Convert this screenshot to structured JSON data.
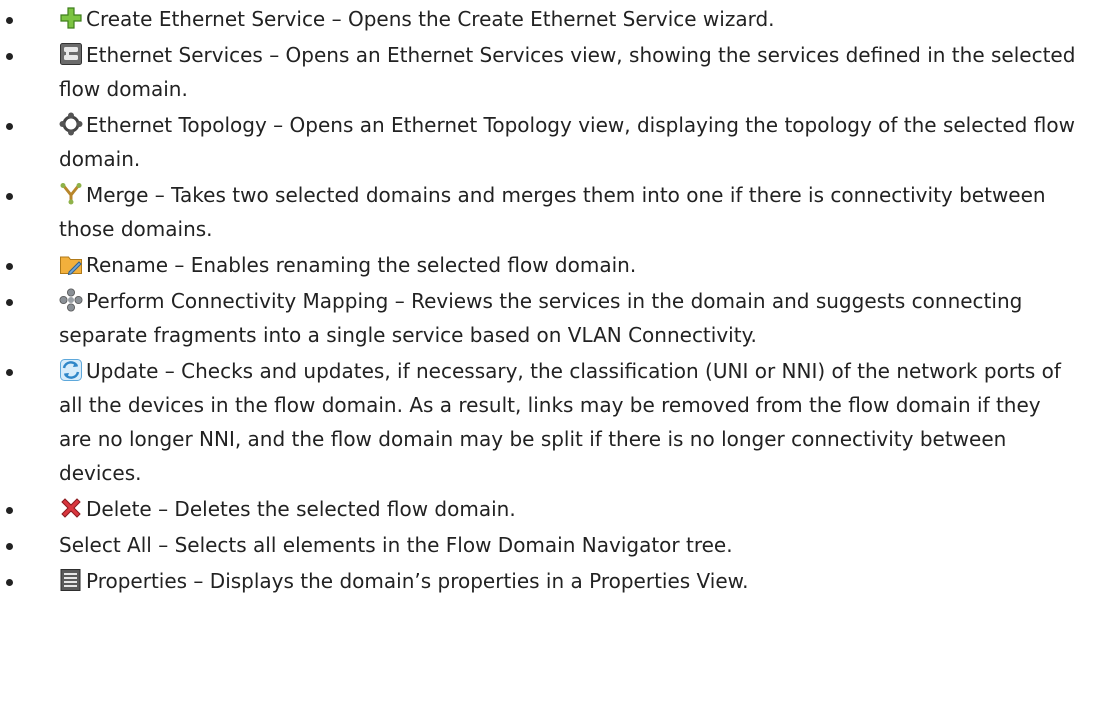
{
  "items": [
    {
      "icon": "create-ethernet-service-icon",
      "text": "Create Ethernet Service – Opens the Create Ethernet Service wizard."
    },
    {
      "icon": "ethernet-services-icon",
      "text": "Ethernet Services – Opens an Ethernet Services view, showing the services defined in the selected flow domain."
    },
    {
      "icon": "ethernet-topology-icon",
      "text": "Ethernet Topology – Opens an Ethernet Topology view, displaying the topology of the selected flow domain."
    },
    {
      "icon": "merge-icon",
      "text": "Merge – Takes two selected domains and merges them into one if there is connectivity between those domains."
    },
    {
      "icon": "rename-icon",
      "text": "Rename – Enables renaming the selected flow domain."
    },
    {
      "icon": "connectivity-mapping-icon",
      "text": "Perform Connectivity Mapping – Reviews the services in the domain and suggests connecting separate fragments into a single service based on VLAN Connectivity."
    },
    {
      "icon": "update-icon",
      "text": "Update – Checks and updates, if necessary, the classification (UNI or NNI) of the network ports of all the devices in the flow domain. As a result, links may be removed from the flow domain if they are no longer NNI, and the flow domain may be split if there is no longer connectivity between devices."
    },
    {
      "icon": "delete-icon",
      "text": "Delete – Deletes the selected flow domain."
    },
    {
      "icon": "",
      "text": "Select All – Selects all elements in the Flow Domain Navigator tree."
    },
    {
      "icon": "properties-icon",
      "text": "Properties – Displays the domain’s properties in a Properties View."
    }
  ]
}
